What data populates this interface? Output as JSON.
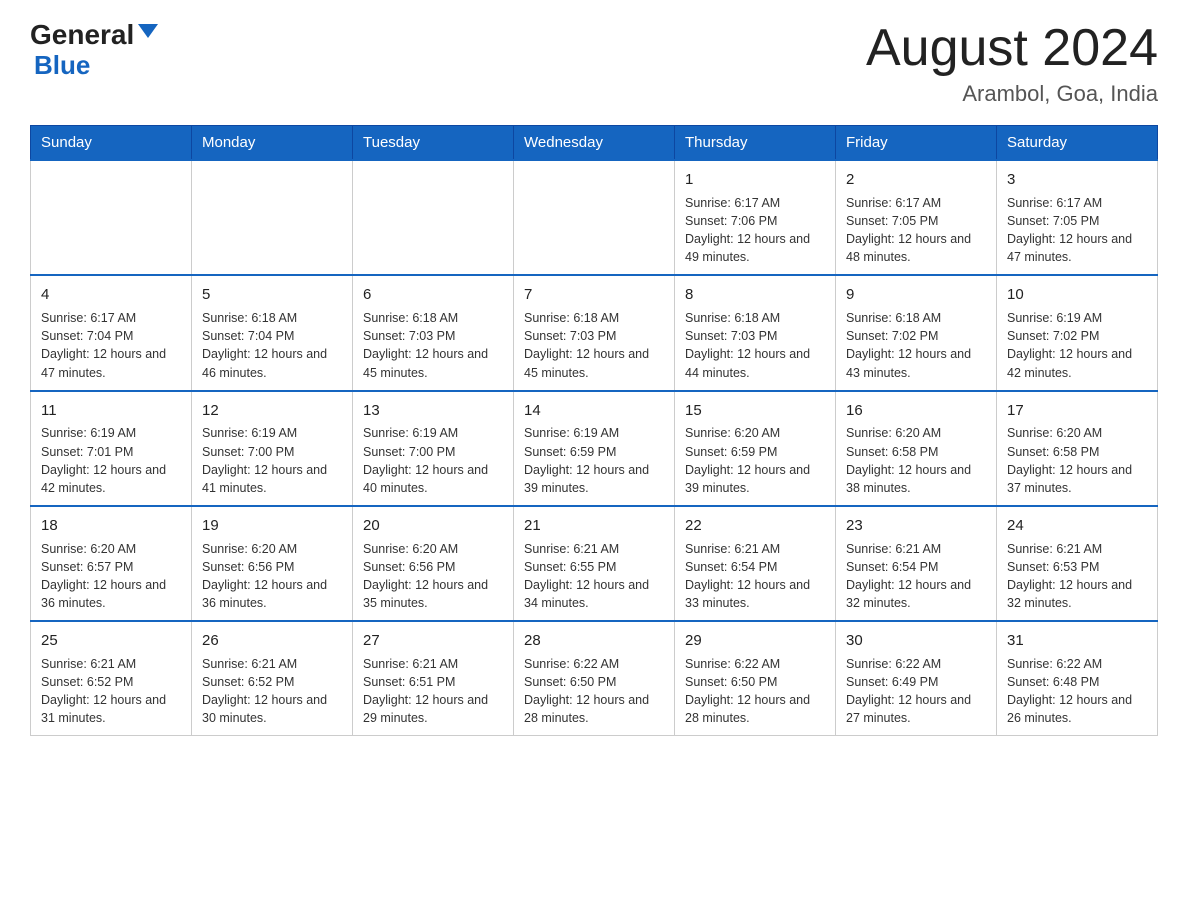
{
  "header": {
    "logo_general": "General",
    "logo_blue": "Blue",
    "month_title": "August 2024",
    "location": "Arambol, Goa, India"
  },
  "weekdays": [
    "Sunday",
    "Monday",
    "Tuesday",
    "Wednesday",
    "Thursday",
    "Friday",
    "Saturday"
  ],
  "weeks": [
    [
      {
        "day": "",
        "info": ""
      },
      {
        "day": "",
        "info": ""
      },
      {
        "day": "",
        "info": ""
      },
      {
        "day": "",
        "info": ""
      },
      {
        "day": "1",
        "info": "Sunrise: 6:17 AM\nSunset: 7:06 PM\nDaylight: 12 hours and 49 minutes."
      },
      {
        "day": "2",
        "info": "Sunrise: 6:17 AM\nSunset: 7:05 PM\nDaylight: 12 hours and 48 minutes."
      },
      {
        "day": "3",
        "info": "Sunrise: 6:17 AM\nSunset: 7:05 PM\nDaylight: 12 hours and 47 minutes."
      }
    ],
    [
      {
        "day": "4",
        "info": "Sunrise: 6:17 AM\nSunset: 7:04 PM\nDaylight: 12 hours and 47 minutes."
      },
      {
        "day": "5",
        "info": "Sunrise: 6:18 AM\nSunset: 7:04 PM\nDaylight: 12 hours and 46 minutes."
      },
      {
        "day": "6",
        "info": "Sunrise: 6:18 AM\nSunset: 7:03 PM\nDaylight: 12 hours and 45 minutes."
      },
      {
        "day": "7",
        "info": "Sunrise: 6:18 AM\nSunset: 7:03 PM\nDaylight: 12 hours and 45 minutes."
      },
      {
        "day": "8",
        "info": "Sunrise: 6:18 AM\nSunset: 7:03 PM\nDaylight: 12 hours and 44 minutes."
      },
      {
        "day": "9",
        "info": "Sunrise: 6:18 AM\nSunset: 7:02 PM\nDaylight: 12 hours and 43 minutes."
      },
      {
        "day": "10",
        "info": "Sunrise: 6:19 AM\nSunset: 7:02 PM\nDaylight: 12 hours and 42 minutes."
      }
    ],
    [
      {
        "day": "11",
        "info": "Sunrise: 6:19 AM\nSunset: 7:01 PM\nDaylight: 12 hours and 42 minutes."
      },
      {
        "day": "12",
        "info": "Sunrise: 6:19 AM\nSunset: 7:00 PM\nDaylight: 12 hours and 41 minutes."
      },
      {
        "day": "13",
        "info": "Sunrise: 6:19 AM\nSunset: 7:00 PM\nDaylight: 12 hours and 40 minutes."
      },
      {
        "day": "14",
        "info": "Sunrise: 6:19 AM\nSunset: 6:59 PM\nDaylight: 12 hours and 39 minutes."
      },
      {
        "day": "15",
        "info": "Sunrise: 6:20 AM\nSunset: 6:59 PM\nDaylight: 12 hours and 39 minutes."
      },
      {
        "day": "16",
        "info": "Sunrise: 6:20 AM\nSunset: 6:58 PM\nDaylight: 12 hours and 38 minutes."
      },
      {
        "day": "17",
        "info": "Sunrise: 6:20 AM\nSunset: 6:58 PM\nDaylight: 12 hours and 37 minutes."
      }
    ],
    [
      {
        "day": "18",
        "info": "Sunrise: 6:20 AM\nSunset: 6:57 PM\nDaylight: 12 hours and 36 minutes."
      },
      {
        "day": "19",
        "info": "Sunrise: 6:20 AM\nSunset: 6:56 PM\nDaylight: 12 hours and 36 minutes."
      },
      {
        "day": "20",
        "info": "Sunrise: 6:20 AM\nSunset: 6:56 PM\nDaylight: 12 hours and 35 minutes."
      },
      {
        "day": "21",
        "info": "Sunrise: 6:21 AM\nSunset: 6:55 PM\nDaylight: 12 hours and 34 minutes."
      },
      {
        "day": "22",
        "info": "Sunrise: 6:21 AM\nSunset: 6:54 PM\nDaylight: 12 hours and 33 minutes."
      },
      {
        "day": "23",
        "info": "Sunrise: 6:21 AM\nSunset: 6:54 PM\nDaylight: 12 hours and 32 minutes."
      },
      {
        "day": "24",
        "info": "Sunrise: 6:21 AM\nSunset: 6:53 PM\nDaylight: 12 hours and 32 minutes."
      }
    ],
    [
      {
        "day": "25",
        "info": "Sunrise: 6:21 AM\nSunset: 6:52 PM\nDaylight: 12 hours and 31 minutes."
      },
      {
        "day": "26",
        "info": "Sunrise: 6:21 AM\nSunset: 6:52 PM\nDaylight: 12 hours and 30 minutes."
      },
      {
        "day": "27",
        "info": "Sunrise: 6:21 AM\nSunset: 6:51 PM\nDaylight: 12 hours and 29 minutes."
      },
      {
        "day": "28",
        "info": "Sunrise: 6:22 AM\nSunset: 6:50 PM\nDaylight: 12 hours and 28 minutes."
      },
      {
        "day": "29",
        "info": "Sunrise: 6:22 AM\nSunset: 6:50 PM\nDaylight: 12 hours and 28 minutes."
      },
      {
        "day": "30",
        "info": "Sunrise: 6:22 AM\nSunset: 6:49 PM\nDaylight: 12 hours and 27 minutes."
      },
      {
        "day": "31",
        "info": "Sunrise: 6:22 AM\nSunset: 6:48 PM\nDaylight: 12 hours and 26 minutes."
      }
    ]
  ]
}
